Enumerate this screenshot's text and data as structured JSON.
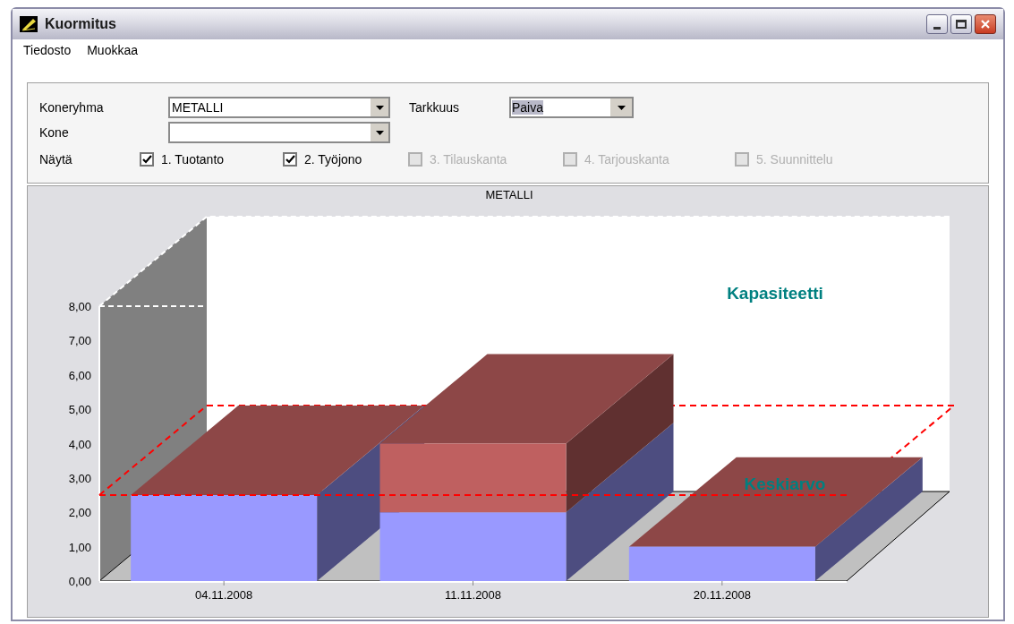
{
  "window": {
    "title": "Kuormitus"
  },
  "menu": [
    {
      "label": "Tiedosto"
    },
    {
      "label": "Muokkaa"
    }
  ],
  "filters": {
    "group_label": "Koneryhma",
    "group_value": "METALLI",
    "precision_label": "Tarkkuus",
    "precision_value": "Paiva",
    "machine_label": "Kone",
    "show_label": "Näytä",
    "options": [
      {
        "label": "1. Tuotanto",
        "checked": true,
        "disabled": false
      },
      {
        "label": "2. Työjono",
        "checked": true,
        "disabled": false
      },
      {
        "label": "3. Tilauskanta",
        "checked": false,
        "disabled": true
      },
      {
        "label": "4. Tarjouskanta",
        "checked": false,
        "disabled": true
      },
      {
        "label": "5. Suunnittelu",
        "checked": false,
        "disabled": true
      }
    ]
  },
  "chart": {
    "chart_data": {
      "type": "bar",
      "title": "METALLI",
      "stacked": true,
      "categories": [
        "04.11.2008",
        "11.11.2008",
        "20.11.2008"
      ],
      "series": [
        {
          "color": "#9999ff",
          "values": [
            2.5,
            2,
            1
          ]
        },
        {
          "color": "#bf6060",
          "values": [
            0,
            2,
            0
          ]
        }
      ],
      "ylim": [
        0,
        8
      ],
      "yticks": [
        {
          "value": 0,
          "label": "0,00"
        },
        {
          "value": 1,
          "label": "1,00"
        },
        {
          "value": 2,
          "label": "2,00"
        },
        {
          "value": 3,
          "label": "3,00"
        },
        {
          "value": 4,
          "label": "4,00"
        },
        {
          "value": 5,
          "label": "5,00"
        },
        {
          "value": 6,
          "label": "6,00"
        },
        {
          "value": 7,
          "label": "7,00"
        },
        {
          "value": 8,
          "label": "8,00"
        }
      ],
      "annotations": [
        {
          "text": "Kapasiteetti"
        }
      ],
      "ref_lines": [
        {
          "axis": "y",
          "value": 2.5,
          "label": "Keskiarvo"
        }
      ]
    }
  }
}
